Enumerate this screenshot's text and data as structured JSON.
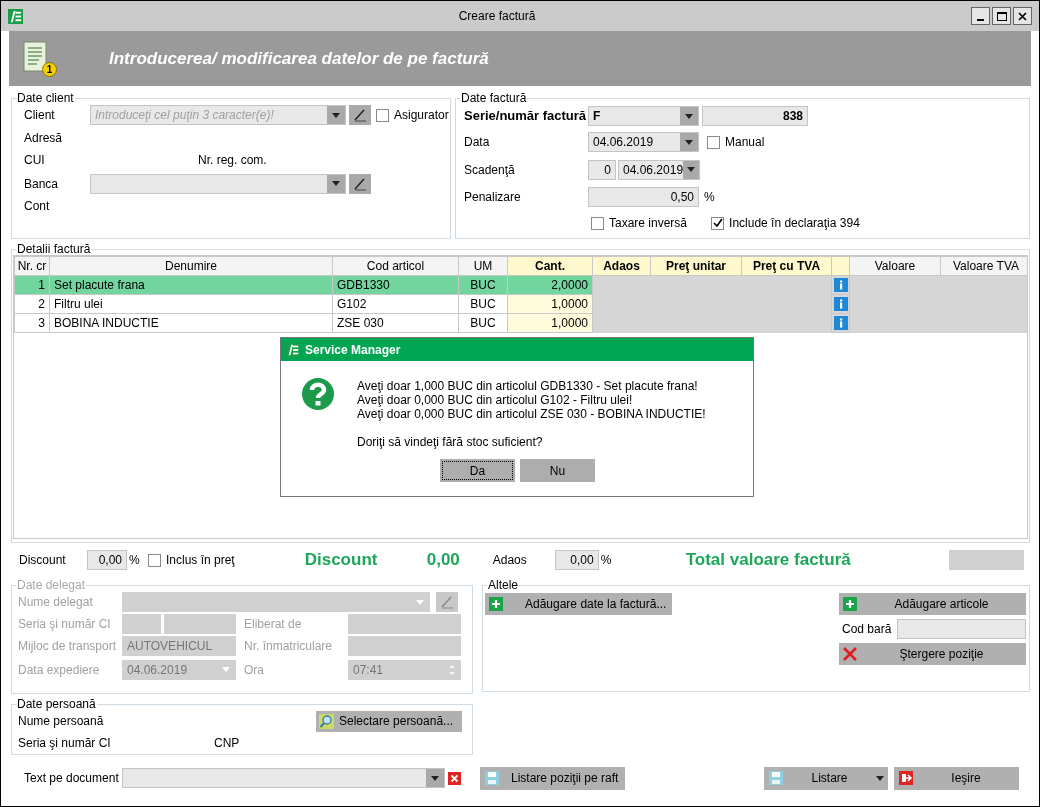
{
  "window": {
    "title": "Creare factură"
  },
  "banner": {
    "title": "Introducerea/ modificarea datelor de pe factură",
    "badge": "1"
  },
  "client": {
    "legend": "Date client",
    "client_label": "Client",
    "client_placeholder": "Introduceţi cel puţin 3 caracter(e)!",
    "asigurator": {
      "label": "Asigurator",
      "checked": false
    },
    "adresa_label": "Adresă",
    "cui_label": "CUI",
    "nr_reg_label": "Nr. reg. com.",
    "banca_label": "Banca",
    "cont_label": "Cont"
  },
  "invoice": {
    "legend": "Date factură",
    "serie_label": "Serie/număr factură",
    "serie": "F",
    "numar": "838",
    "data_label": "Data",
    "data": "04.06.2019",
    "manual": {
      "label": "Manual",
      "checked": false
    },
    "scadenta_label": "Scadenţă",
    "scadenta_days": "0",
    "scadenta_date": "04.06.2019",
    "penalizare_label": "Penalizare",
    "penalizare": "0,50",
    "penalizare_unit": "%",
    "taxare": {
      "label": "Taxare inversă",
      "checked": false
    },
    "include": {
      "label": "Include în declaraţia 394",
      "checked": true
    }
  },
  "details": {
    "legend": "Detalii factură",
    "columns": [
      {
        "label": "Nr. cr",
        "kind": "data",
        "highlight": false
      },
      {
        "label": "Denumire",
        "kind": "data",
        "highlight": false
      },
      {
        "label": "Cod articol",
        "kind": "data",
        "highlight": false
      },
      {
        "label": "UM",
        "kind": "data",
        "highlight": false
      },
      {
        "label": "Cant.",
        "kind": "data",
        "highlight": true
      },
      {
        "label": "Adaos",
        "kind": "empty",
        "highlight": true
      },
      {
        "label": "Preţ unitar",
        "kind": "empty",
        "highlight": true
      },
      {
        "label": "Preţ cu TVA",
        "kind": "empty",
        "highlight": true
      },
      {
        "kind": "info",
        "highlight": true
      },
      {
        "label": "Valoare",
        "kind": "empty",
        "highlight": false
      },
      {
        "label": "Valoare TVA",
        "kind": "empty",
        "highlight": false
      }
    ],
    "rows": [
      {
        "cells": [
          "1",
          "Set placute frana",
          "GDB1330",
          "BUC",
          "2,0000"
        ],
        "selected": true
      },
      {
        "cells": [
          "2",
          "Filtru ulei",
          "G102",
          "BUC",
          "1,0000"
        ],
        "selected": false
      },
      {
        "cells": [
          "3",
          "BOBINA INDUCTIE",
          "ZSE 030",
          "BUC",
          "1,0000"
        ],
        "selected": false
      }
    ]
  },
  "dialog": {
    "title": "Service Manager",
    "lines": [
      "Aveţi doar 1,000 BUC din articolul GDB1330 - Set placute frana!",
      "Aveţi doar 0,000 BUC din articolul G102 - Filtru ulei!",
      "Aveţi doar 0,000 BUC din articolul ZSE 030 - BOBINA INDUCTIE!"
    ],
    "question": "Doriţi să vindeţi fără stoc suficient?",
    "buttons": [
      {
        "label": "Da",
        "focused": true
      },
      {
        "label": "Nu",
        "focused": false
      }
    ]
  },
  "totals": {
    "discount_label": "Discount",
    "discount_value": "0,00",
    "discount_unit": "%",
    "inclus": {
      "label": "Inclus în preţ",
      "checked": false
    },
    "discount_title": "Discount",
    "discount_total": "0,00",
    "adaos_label": "Adaos",
    "adaos_value": "0,00",
    "adaos_unit": "%",
    "total_title": "Total valoare factură"
  },
  "delegate": {
    "legend": "Date delegat",
    "disabled": true,
    "nume_label": "Nume delegat",
    "ci_label": "Seria şi număr CI",
    "eliberat_label": "Eliberat de",
    "transport_label": "Mijloc de transport",
    "transport": "AUTOVEHICUL",
    "inmatriculare_label": "Nr. înmatriculare",
    "expediere_label": "Data expediere",
    "expediere": "04.06.2019",
    "ora_label": "Ora",
    "ora": "07:41"
  },
  "other": {
    "legend": "Altele",
    "add_data": "Adăugare date la factură...",
    "add_items": "Adăugare articole",
    "barcode_label": "Cod bară",
    "delete": "Ştergere poziţie"
  },
  "person": {
    "legend": "Date persoană",
    "nume_label": "Nume persoană",
    "select": "Selectare persoană...",
    "ci_label": "Seria şi număr CI",
    "cnp_label": "CNP"
  },
  "footer": {
    "text_label": "Text pe document",
    "shelf": "Listare poziţii pe raft",
    "print": "Listare",
    "exit": "Ieşire"
  }
}
